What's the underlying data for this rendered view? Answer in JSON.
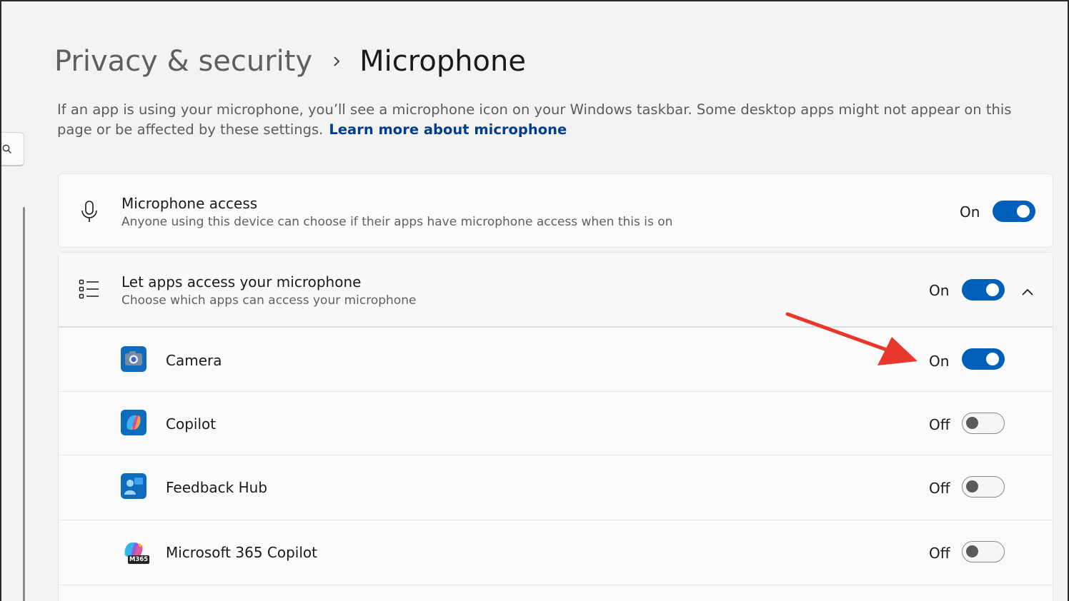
{
  "breadcrumb": {
    "parent": "Privacy & security",
    "current": "Microphone"
  },
  "description": {
    "text": "If an app is using your microphone, you’ll see a microphone icon on your Windows taskbar. Some desktop apps might not appear on this page or be affected by these settings.",
    "link": "Learn more about microphone"
  },
  "microphone_access": {
    "icon": "microphone-icon",
    "title": "Microphone access",
    "subtitle": "Anyone using this device can choose if their apps have microphone access when this is on",
    "state": "On"
  },
  "let_apps": {
    "icon": "list-icon",
    "title": "Let apps access your microphone",
    "subtitle": "Choose which apps can access your microphone",
    "state": "On"
  },
  "apps": [
    {
      "name": "Camera",
      "state": "On",
      "icon": "camera-app-icon"
    },
    {
      "name": "Copilot",
      "state": "Off",
      "icon": "copilot-app-icon"
    },
    {
      "name": "Feedback Hub",
      "state": "Off",
      "icon": "feedback-hub-app-icon"
    },
    {
      "name": "Microsoft 365 Copilot",
      "state": "Off",
      "icon": "m365-copilot-app-icon",
      "badge": "M365"
    }
  ],
  "colors": {
    "accent": "#005fb8",
    "link": "#003e92",
    "annotation_arrow": "#e8382d"
  }
}
